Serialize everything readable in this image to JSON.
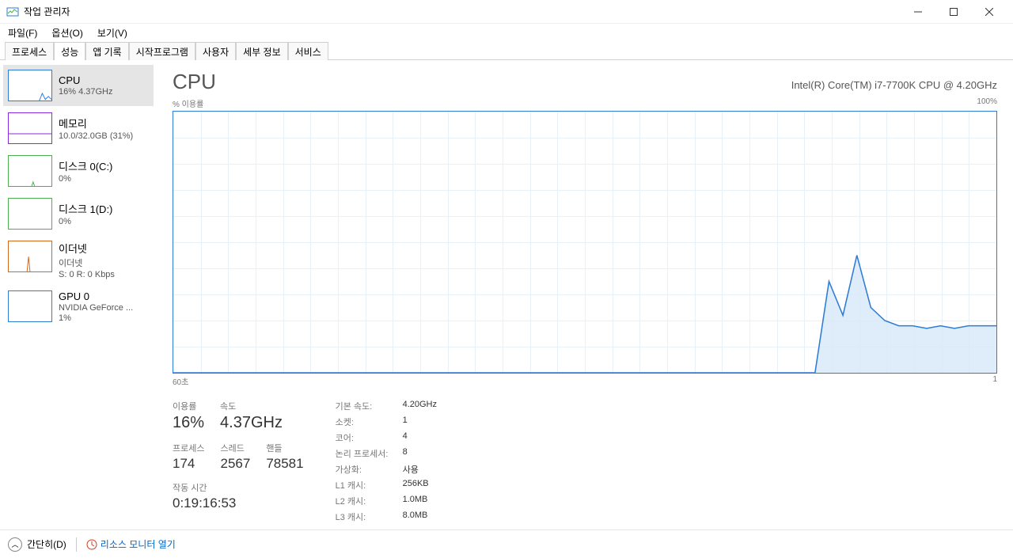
{
  "window": {
    "title": "작업 관리자"
  },
  "menu": {
    "file": "파일(F)",
    "options": "옵션(O)",
    "view": "보기(V)"
  },
  "tabs": [
    "프로세스",
    "성능",
    "앱 기록",
    "시작프로그램",
    "사용자",
    "세부 정보",
    "서비스"
  ],
  "active_tab": 1,
  "sidebar": [
    {
      "title": "CPU",
      "sub": "16% 4.37GHz",
      "color": "#2e7cd6"
    },
    {
      "title": "메모리",
      "sub": "10.0/32.0GB (31%)",
      "color": "#8a2be2"
    },
    {
      "title": "디스크 0(C:)",
      "sub": "0%",
      "color": "#4caf50"
    },
    {
      "title": "디스크 1(D:)",
      "sub": "0%",
      "color": "#4caf50"
    },
    {
      "title": "이더넷",
      "sub": "이더넷",
      "sub2": "S: 0 R: 0 Kbps",
      "color": "#d2691e"
    },
    {
      "title": "GPU 0",
      "sub": "NVIDIA GeForce ...",
      "sub2": "1%",
      "color": "#2e7cd6"
    }
  ],
  "main": {
    "title": "CPU",
    "subtitle": "Intel(R) Core(TM) i7-7700K CPU @ 4.20GHz",
    "y_label": "% 이용률",
    "y_max": "100%",
    "x_left": "60초",
    "x_right": "1"
  },
  "stats_left": {
    "util_label": "이용률",
    "util": "16%",
    "speed_label": "속도",
    "speed": "4.37GHz",
    "proc_label": "프로세스",
    "proc": "174",
    "threads_label": "스레드",
    "threads": "2567",
    "handles_label": "핸들",
    "handles": "78581",
    "uptime_label": "작동 시간",
    "uptime": "0:19:16:53"
  },
  "stats_right": [
    {
      "k": "기본 속도:",
      "v": "4.20GHz"
    },
    {
      "k": "소켓:",
      "v": "1"
    },
    {
      "k": "코어:",
      "v": "4"
    },
    {
      "k": "논리 프로세서:",
      "v": "8"
    },
    {
      "k": "가상화:",
      "v": "사용"
    },
    {
      "k": "L1 캐시:",
      "v": "256KB"
    },
    {
      "k": "L2 캐시:",
      "v": "1.0MB"
    },
    {
      "k": "L3 캐시:",
      "v": "8.0MB"
    }
  ],
  "footer": {
    "collapse": "간단히(D)",
    "link": "리소스 모니터 열기"
  },
  "chart_data": {
    "type": "line",
    "title": "CPU % 이용률",
    "xlabel": "초",
    "ylabel": "% 이용률",
    "ylim": [
      0,
      100
    ],
    "xlim": [
      60,
      1
    ],
    "x": [
      60,
      55,
      50,
      45,
      40,
      35,
      30,
      25,
      20,
      15,
      14,
      13,
      12,
      11,
      10,
      9,
      8,
      7,
      6,
      5,
      4,
      3,
      2,
      1
    ],
    "values": [
      0,
      0,
      0,
      0,
      0,
      0,
      0,
      0,
      0,
      0,
      0,
      35,
      22,
      45,
      25,
      20,
      18,
      18,
      17,
      18,
      17,
      18,
      18,
      18
    ]
  }
}
